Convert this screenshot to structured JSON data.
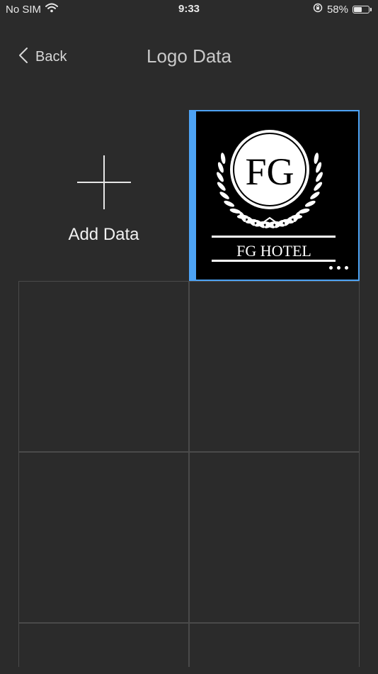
{
  "status": {
    "carrier": "No SIM",
    "time": "9:33",
    "battery_percent": "58%",
    "battery_level": 0.58
  },
  "nav": {
    "back_label": "Back",
    "title": "Logo Data"
  },
  "grid": {
    "add_label": "Add Data",
    "items": [
      {
        "logo_initials": "FG",
        "logo_name": "FG HOTEL"
      }
    ]
  },
  "colors": {
    "background": "#2b2b2b",
    "selection": "#4da3f5",
    "cell_border": "#4a4a4a"
  }
}
